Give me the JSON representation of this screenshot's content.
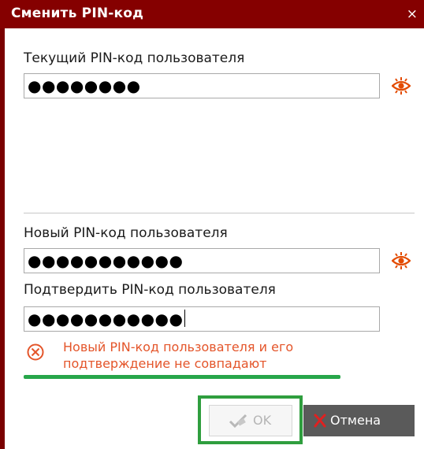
{
  "dialog": {
    "title": "Сменить PIN-код",
    "close_symbol": "×",
    "colors": {
      "titlebar": "#850000",
      "error_text": "#e4552a",
      "eye_icon": "#e34b00",
      "highlight": "#2f9e3e",
      "cancel_bg": "#5a5a5a"
    }
  },
  "current_pin": {
    "label": "Текущий PIN-код пользователя",
    "masked_value": "●●●●●●●●",
    "toggle_icon": "eye-reveal-icon"
  },
  "new_pin": {
    "label": "Новый PIN-код пользователя",
    "masked_value": "●●●●●●●●●●●",
    "toggle_icon": "eye-reveal-icon"
  },
  "confirm_pin": {
    "label": "Подтвердить PIN-код пользователя",
    "masked_value": "●●●●●●●●●●●"
  },
  "error": {
    "icon": "error-circle-x-icon",
    "line1": "Новый PIN-код пользователя и его",
    "line2": "подтверждение не совпадают"
  },
  "buttons": {
    "ok_label": "OK",
    "ok_enabled": false,
    "ok_icon": "checkmark-pencil-icon",
    "cancel_label": "Отмена",
    "cancel_icon": "red-x-icon"
  }
}
